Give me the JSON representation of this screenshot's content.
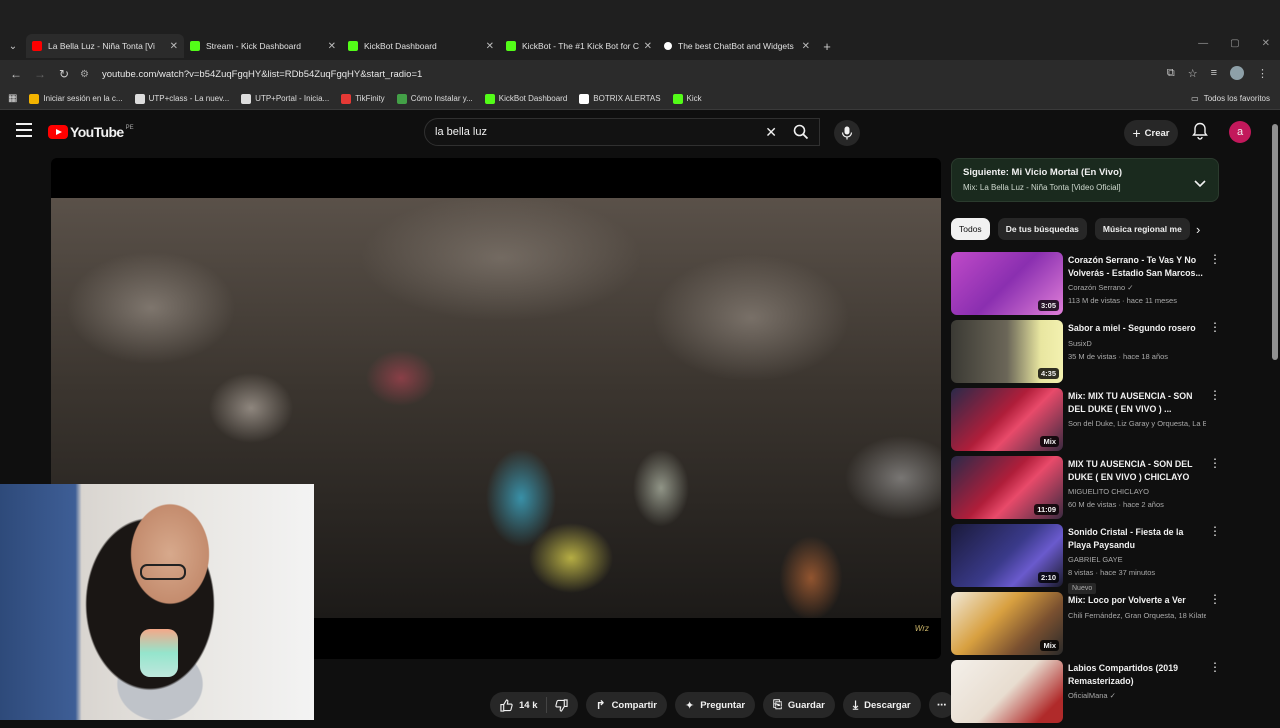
{
  "browser": {
    "tabs": [
      {
        "title": "La Bella Luz - Niña Tonta [Vi",
        "fav_color": "#ff0000",
        "active": true
      },
      {
        "title": "Stream - Kick Dashboard",
        "fav_color": "#53fc18",
        "active": false
      },
      {
        "title": "KickBot Dashboard",
        "fav_color": "#53fc18",
        "active": false
      },
      {
        "title": "KickBot - The #1 Kick Bot for C",
        "fav_color": "#53fc18",
        "active": false
      },
      {
        "title": "The best ChatBot and Widgets",
        "fav_color": "#ffffff",
        "active": false
      }
    ],
    "url": "youtube.com/watch?v=b54ZuqFgqHY&list=RDb54ZuqFgqHY&start_radio=1",
    "bookmarks": [
      {
        "label": "Iniciar sesión en la c...",
        "color": "#f4b400"
      },
      {
        "label": "UTP+class - La nuev...",
        "color": "#dddddd"
      },
      {
        "label": "UTP+Portal - Inicia...",
        "color": "#dddddd"
      },
      {
        "label": "TikFinity",
        "color": "#e53935"
      },
      {
        "label": "Cómo Instalar y...",
        "color": "#43a047"
      },
      {
        "label": "KickBot Dashboard",
        "color": "#53fc18"
      },
      {
        "label": "BOTRIX ALERTAS",
        "color": "#ffffff"
      },
      {
        "label": "Kick",
        "color": "#53fc18"
      }
    ],
    "all_bookmarks": "Todos los favoritos"
  },
  "youtube": {
    "logo": "YouTube",
    "country": "PE",
    "search_value": "la bella luz",
    "create_label": "Crear",
    "account_initial": "a"
  },
  "player": {
    "watermark": "Wrz"
  },
  "actions": {
    "likes": "14 k",
    "share": "Compartir",
    "ask": "Preguntar",
    "save": "Guardar",
    "download": "Descargar"
  },
  "queue": {
    "next": "Siguiente: Mi Vicio Mortal (En Vivo)",
    "mix": "Mix: La Bella Luz - Niña Tonta [Video Oficial]"
  },
  "chips": [
    "Todos",
    "De tus búsquedas",
    "Música regional me"
  ],
  "recommendations": [
    {
      "title": "Corazón Serrano - Te Vas Y No Volverás - Estadio San Marcos...",
      "channel": "Corazón Serrano ✓",
      "meta": "113 M de vistas · hace 11 meses",
      "duration": "3:05",
      "thumb": "linear-gradient(135deg,#c04ac8,#8a2fb0 50%,#e07fd8)",
      "badge": ""
    },
    {
      "title": "Sabor a miel - Segundo rosero",
      "channel": "SusixD",
      "meta": "35 M de vistas · hace 18 años",
      "duration": "4:35",
      "thumb": "linear-gradient(90deg,#3b3a34,#6b6658 50%,#e8e6a0 80%,#f3f1b0)",
      "badge": ""
    },
    {
      "title": "Mix: MIX TU AUSENCIA - SON DEL DUKE ( EN VIVO ) ...",
      "channel": "Son del Duke, Liz Garay y Orquesta, La B...",
      "meta": "",
      "duration": "Mix",
      "thumb": "linear-gradient(135deg,#2a2a4a,#b01e3a 45%,#e84a6a 60%,#3a2a40)",
      "badge": ""
    },
    {
      "title": "MIX TU AUSENCIA - SON DEL DUKE ( EN VIVO ) CHICLAYO",
      "channel": "MIGUELITO CHICLAYO",
      "meta": "60 M de vistas · hace 2 años",
      "duration": "11:09",
      "thumb": "linear-gradient(135deg,#2a2a4a,#b01e3a 45%,#e84a6a 60%,#3a2a40)",
      "badge": ""
    },
    {
      "title": "Sonido Cristal - Fiesta de la Playa Paysandu",
      "channel": "GABRIEL GAYE",
      "meta": "8 vistas · hace 37 minutos",
      "duration": "2:10",
      "thumb": "linear-gradient(135deg,#1a1a3a,#3a3a8a 50%,#6a5acd 70%,#1a1a2a)",
      "badge": "Nuevo"
    },
    {
      "title": "Mix: Loco por Volverte a Ver",
      "channel": "Chili Fernández, Gran Orquesta, 18 Kilate...",
      "meta": "",
      "duration": "Mix",
      "thumb": "linear-gradient(135deg,#f0e8d8,#d8a040 40%,#7a5030 70%,#2a2a2a)",
      "badge": ""
    },
    {
      "title": "Labios Compartidos (2019 Remasterizado)",
      "channel": "OficialMana ✓",
      "meta": "",
      "duration": "",
      "thumb": "linear-gradient(135deg,#f4f0ea,#e8ddd0 50%,#b02a2a 85%)",
      "badge": ""
    }
  ]
}
